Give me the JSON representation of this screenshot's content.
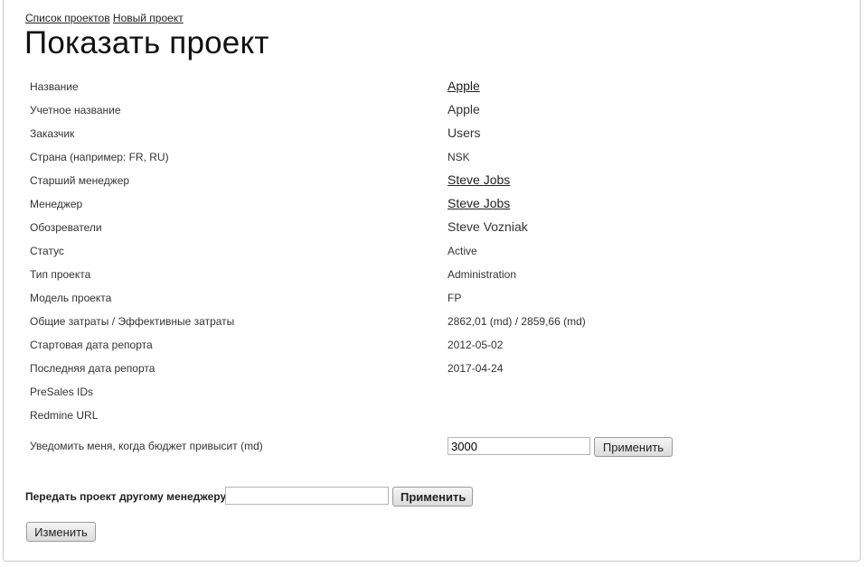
{
  "nav": {
    "projects_link": "Список проектов",
    "new_project_link": "Новый проект"
  },
  "page_title": "Показать проект",
  "details": [
    {
      "label": "Название",
      "value": "Apple"
    },
    {
      "label": "Учетное название",
      "value": "Apple"
    },
    {
      "label": "Заказчик",
      "value": "Users"
    },
    {
      "label": "Страна (например: FR, RU)",
      "value": "NSK"
    },
    {
      "label": "Старший менеджер",
      "value": "Steve Jobs"
    },
    {
      "label": "Менеджер",
      "value": "Steve Jobs"
    },
    {
      "label": "Обозреватели",
      "value": "Steve Vozniak"
    },
    {
      "label": "Статус",
      "value": "Active"
    },
    {
      "label": "Тип проекта",
      "value": "Administration"
    },
    {
      "label": "Модель проекта",
      "value": "FP"
    },
    {
      "label": "Общие затраты / Эффективные затраты",
      "value": "2862,01 (md) / 2859,66 (md)"
    },
    {
      "label": "Стартовая дата репорта",
      "value": "2012-05-02"
    },
    {
      "label": "Последняя дата репорта",
      "value": "2017-04-24"
    },
    {
      "label": "PreSales IDs",
      "value": ""
    },
    {
      "label": "Redmine URL",
      "value": ""
    }
  ],
  "budget_notify": {
    "label": "Уведомить меня, когда бюджет привысит (md)",
    "value": "3000",
    "apply_label": "Применить"
  },
  "transfer": {
    "label": "Передать проект другому менеджеру",
    "value": "",
    "apply_label": "Применить"
  },
  "edit_label": "Изменить"
}
